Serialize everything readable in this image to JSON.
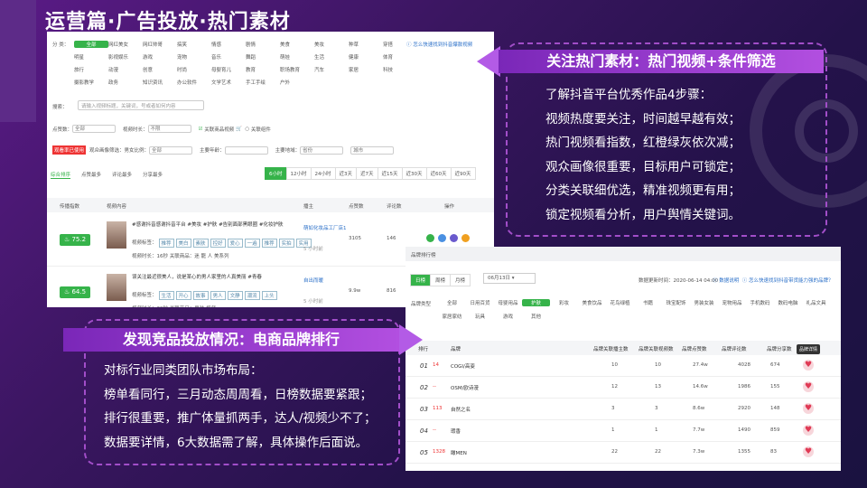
{
  "title": "运营篇·广告投放·热门素材",
  "panel1": {
    "cat_label": "分 类：",
    "categories": [
      "全部",
      "网红美女",
      "网红帅哥",
      "搞笑",
      "情感",
      "剧情",
      "美食",
      "美妆",
      "种草",
      "穿搭",
      "明星",
      "影视娱乐",
      "游戏",
      "宠物",
      "音乐",
      "舞蹈",
      "萌娃",
      "生活",
      "健康",
      "体育",
      "旅行",
      "动漫",
      "创意",
      "时尚",
      "母婴育儿",
      "教育",
      "职场教育",
      "汽车",
      "家居",
      "科技",
      "摄影教学",
      "政务",
      "知识资讯",
      "办公软件",
      "文学艺术",
      "手工手绘",
      "户外"
    ],
    "help_link": "怎么快速找到抖音爆款视频",
    "search_label": "搜索：",
    "search_placeholder": "请输入视频标题，关键词，号或者如何内容",
    "filter1": {
      "likes_label": "点赞数：",
      "likes_val": "全部",
      "duration_label": "视频时长：",
      "duration_val": "不限",
      "cb1": "关联商品视频",
      "cb2": "关联组件"
    },
    "filter2": {
      "badge": "观看率已使用",
      "audience_label": "观众画像筛选：",
      "gender_label": "男女比例：",
      "gender_val": "全部",
      "age_label": "主要年龄：",
      "region_label": "主要地域：",
      "region_val": "省份",
      "city_val": "城市"
    },
    "tabs": [
      "综合排序",
      "点赞最多",
      "评论最多",
      "分享最多"
    ],
    "time_btns": [
      "6小时",
      "12小时",
      "24小时",
      "近3天",
      "近7天",
      "近15天",
      "近30天",
      "近60天",
      "近90天"
    ],
    "table_headers": [
      "传播指数",
      "视频内容",
      "播主",
      "点赞数",
      "评论数",
      "操作"
    ],
    "rows": [
      {
        "index": "75.2",
        "title": "#感谢抖音感谢抖音平台 #美妆 #护肤 #告别面部黑眼圈 #化妆护肤",
        "tags_label": "视频标签：",
        "tags": [
          "推荐",
          "美白",
          "素肤",
          "控好",
          "爱心",
          "一遍",
          "推荐",
          "实拍",
          "实用"
        ],
        "meta": "视频时长：16秒   关联商品：迷 龍 人 美系列",
        "blogger": "萌如化妆品工厂店1",
        "time": "5 小时前",
        "likes": "3105",
        "comments": "146"
      },
      {
        "index": "64.5",
        "title": "误关注最近很美人，说是某心的男人家里的人真美丽 #青春",
        "tags_label": "视频标签：",
        "tags": [
          "生活",
          "开心",
          "故事",
          "男人",
          "文静",
          "潮流",
          "上头"
        ],
        "meta": "视频时长：39秒   关联商品：男装 视频",
        "blogger": "自出而暖",
        "time": "5 小时前",
        "likes": "9.9w",
        "comments": "816"
      }
    ]
  },
  "panel2": {
    "header": "品牌排行榜",
    "seg": [
      "日榜",
      "周榜",
      "月榜"
    ],
    "date": "06月13日",
    "update_text": "数据更新时间：2020-06-14 04:00",
    "links": [
      "数据说明",
      "怎么快速找到抖音带货能力强的品牌？"
    ],
    "cat_label": "品牌类型",
    "categories": [
      "全部",
      "日用百货",
      "母婴用品",
      "护肤",
      "彩妆",
      "美食饮品",
      "花鸟绿植",
      "书籍",
      "珠宝配饰",
      "男装女装",
      "宠物用品",
      "手机数码",
      "数码电脑",
      "礼品文具",
      "家居家纺",
      "玩具",
      "游戏",
      "其他"
    ],
    "headers": [
      "排行",
      "品牌",
      "品牌关联播主数",
      "品牌关联视频数",
      "品牌点赞数",
      "品牌评论数",
      "品牌分享数"
    ],
    "tooltip": "品牌详情",
    "rows": [
      {
        "rank": "01",
        "change": "14",
        "brand": "COGI/高姿",
        "a": "10",
        "b": "10",
        "c": "27.4w",
        "d": "4028",
        "e": "674"
      },
      {
        "rank": "02",
        "change": "--",
        "brand": "OSM/欧诗漫",
        "a": "12",
        "b": "13",
        "c": "14.6w",
        "d": "1986",
        "e": "155"
      },
      {
        "rank": "03",
        "change": "113",
        "brand": "自然之名",
        "a": "3",
        "b": "3",
        "c": "8.6w",
        "d": "2920",
        "e": "148"
      },
      {
        "rank": "04",
        "change": "--",
        "brand": "瑕香",
        "a": "1",
        "b": "1",
        "c": "7.7w",
        "d": "1490",
        "e": "859"
      },
      {
        "rank": "05",
        "change": "1328",
        "brand": "瞰MEN",
        "a": "22",
        "b": "22",
        "c": "7.3w",
        "d": "1355",
        "e": "83"
      }
    ]
  },
  "callout1": {
    "banner": "关注热门素材：热门视频+条件筛选",
    "lines": [
      "了解抖音平台优秀作品4步骤：",
      "视频热度要关注，时间越早越有效；",
      "热门视频看指数，红橙绿灰依次减；",
      "观众画像很重要，目标用户可锁定；",
      "分类关联细优选，精准视频更有用；",
      "锁定视频看分析，用户舆情关键词。"
    ]
  },
  "callout2": {
    "banner": "发现竞品投放情况：电商品牌排行",
    "lines": [
      "对标行业同类团队市场布局：",
      "榜单看同行，三月动态周周看，日榜数据要紧跟；",
      "排行很重要，推广体量抓两手，达人/视频少不了；",
      "数据要详情，6大数据需了解，具体操作后面说。"
    ]
  },
  "colors": {
    "green": "#36b34a",
    "purple": "#b35be6",
    "bg": "#2a1450"
  }
}
